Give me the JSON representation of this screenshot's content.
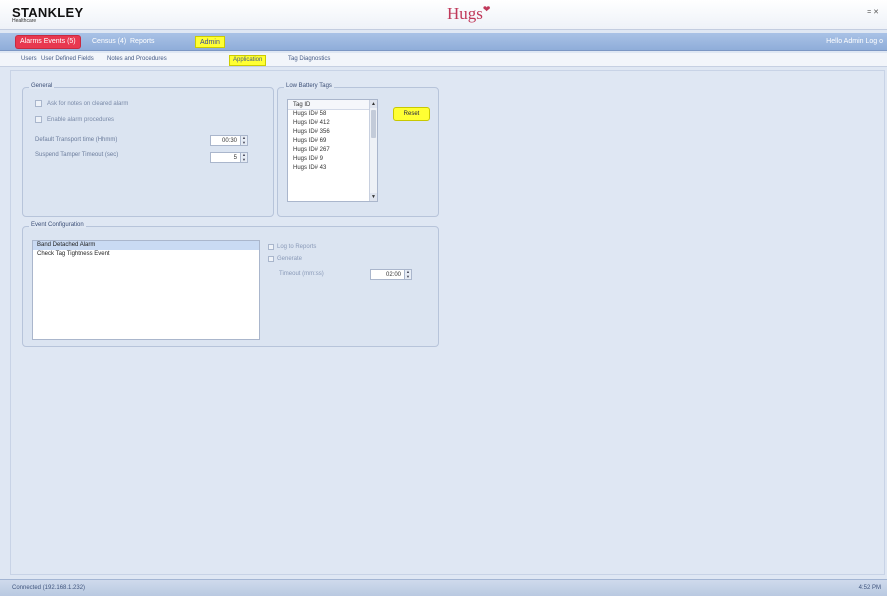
{
  "window": {
    "brand": "STANKLEY",
    "brand_sub": "Healthcare",
    "app_logo": "Hugs",
    "controls": "= ✕"
  },
  "main_nav": {
    "alarms": "Alarms Events (5)",
    "census": "Census (4)",
    "reports": "Reports",
    "admin": "Admin",
    "user_info": "Hello Admin  Log o"
  },
  "sub_nav": {
    "users": "Users",
    "user_defined_fields": "User Defined Fields",
    "notes_procedures": "Notes and Procedures",
    "application": "Application",
    "tag_diagnostics": "Tag Diagnostics"
  },
  "general": {
    "legend": "General",
    "ask_notes": "Ask for notes on cleared alarm",
    "enable_procedures": "Enable alarm procedures",
    "transport_label": "Default Transport time (Hhmm)",
    "transport_value": "00:30",
    "tamper_label": "Suspend Tamper Timeout (sec)",
    "tamper_value": "5"
  },
  "low_battery": {
    "legend": "Low Battery Tags",
    "header": "Tag ID",
    "tags": [
      "Hugs ID# 58",
      "Hugs ID# 412",
      "Hugs ID# 356",
      "Hugs ID# 69",
      "Hugs ID# 267",
      "Hugs ID# 9",
      "Hugs ID# 43"
    ],
    "reset_label": "Reset"
  },
  "event_config": {
    "legend": "Event Configuration",
    "events": [
      "Band Detached Alarm",
      "Check Tag Tightness Event"
    ],
    "log_reports": "Log to Reports",
    "generate": "Generate",
    "timeout_label": "Timeout (mm:ss)",
    "timeout_value": "02:00"
  },
  "status": {
    "connection": "Connected (192.168.1.232)",
    "time": "4:52 PM"
  }
}
